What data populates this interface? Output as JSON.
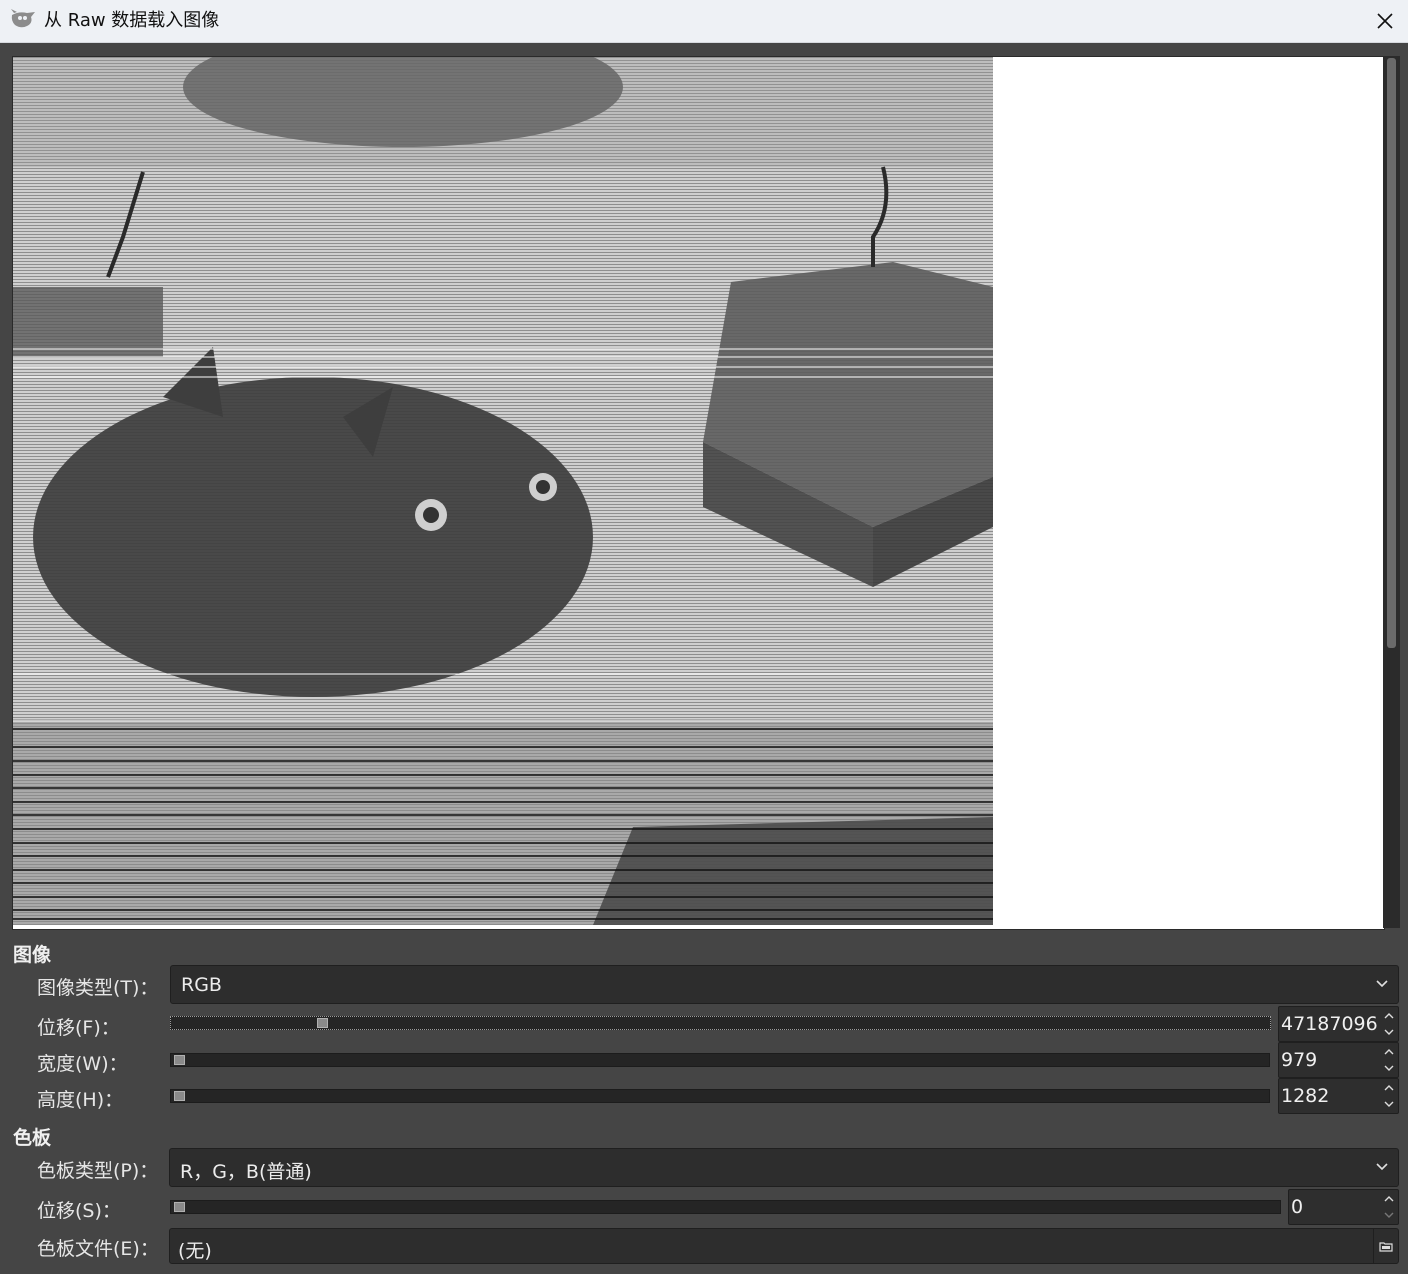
{
  "window": {
    "title": "从 Raw 数据载入图像",
    "icon": "gimp-icon",
    "close": "close-icon"
  },
  "image_section": {
    "title": "图像",
    "type_label": "图像类型(T)：",
    "type_value": "RGB",
    "offset_label": "位移(F)：",
    "offset_value": "47187096",
    "offset_fraction": 0.14,
    "width_label": "宽度(W)：",
    "width_value": "979",
    "height_label": "高度(H)：",
    "height_value": "1282"
  },
  "palette_section": {
    "title": "色板",
    "type_label": "色板类型(P)：",
    "type_value": "R，G，B(普通)",
    "offset_label": "位移(S)：",
    "offset_value": "0",
    "file_label": "色板文件(E)：",
    "file_value": "(无)"
  },
  "colors": {
    "dialog_bg": "#454545",
    "field_bg": "#2d2d2d",
    "titlebar_bg": "#eef1f5"
  }
}
